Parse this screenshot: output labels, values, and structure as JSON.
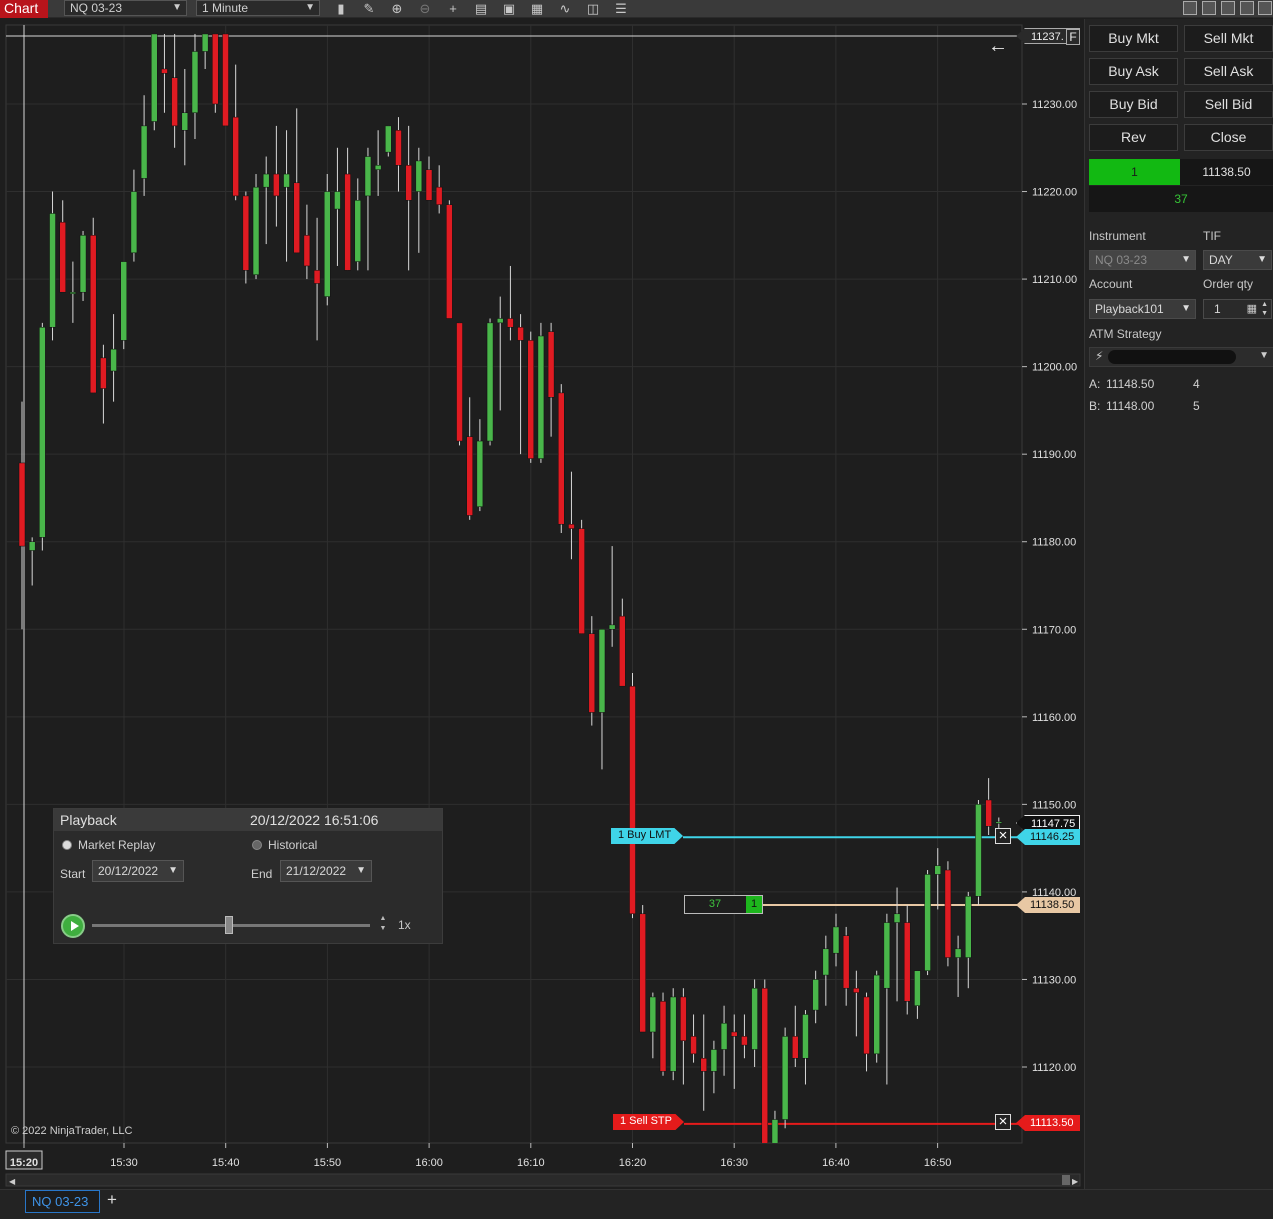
{
  "toolbar": {
    "chart_tab": "Chart",
    "instrument": "NQ 03-23",
    "interval": "1 Minute",
    "icons": [
      "bar-type-icon",
      "draw-tool-icon",
      "zoom-in-icon",
      "zoom-out-icon",
      "crosshair-icon",
      "data-box-icon",
      "template-icon",
      "chart-style-icon",
      "indicators-icon",
      "strategies-icon",
      "properties-icon"
    ]
  },
  "chart": {
    "copyright": "© 2022 NinjaTrader, LLC",
    "price_labels": [
      "11230.00",
      "11220.00",
      "11210.00",
      "11200.00",
      "11190.00",
      "11180.00",
      "11170.00",
      "11160.00",
      "11150.00",
      "11140.00",
      "11130.00",
      "11120.00"
    ],
    "time_labels": [
      "15:20",
      "15:30",
      "15:40",
      "15:50",
      "16:00",
      "16:10",
      "16:20",
      "16:30",
      "16:40",
      "16:50"
    ],
    "top_marker": "11237.",
    "top_marker_flag": "F",
    "last_price": "11147.75",
    "buy_lmt_label": "1  Buy LMT",
    "buy_lmt_price": "11146.25",
    "position_price": "11138.50",
    "sell_stp_label": "1  Sell STP",
    "sell_stp_price": "11113.50",
    "fill_qty": "37",
    "fill_pos": "1",
    "colors": {
      "up": "#49b64a",
      "down": "#e01b22",
      "buy_lmt": "#3fd4e8",
      "position": "#e8c8a4",
      "sell_stp": "#e51b1b"
    }
  },
  "chart_data": {
    "type": "candlestick",
    "instrument": "NQ 03-23",
    "interval": "1 Minute",
    "x_range": [
      "15:20",
      "16:51"
    ],
    "ylim": [
      11108,
      11238
    ],
    "candles": [
      {
        "o": 11189.0,
        "h": 11196.0,
        "l": 11170.0,
        "c": 11179.5
      },
      {
        "o": 11179.0,
        "h": 11180.5,
        "l": 11175.0,
        "c": 11180.0
      },
      {
        "o": 11180.5,
        "h": 11205.0,
        "l": 11179.0,
        "c": 11204.5
      },
      {
        "o": 11204.5,
        "h": 11220.0,
        "l": 11203.0,
        "c": 11217.5
      },
      {
        "o": 11216.5,
        "h": 11219.0,
        "l": 11208.5,
        "c": 11208.5
      },
      {
        "o": 11208.5,
        "h": 11212.0,
        "l": 11205.0,
        "c": 11208.5
      },
      {
        "o": 11208.5,
        "h": 11215.5,
        "l": 11207.5,
        "c": 11215.0
      },
      {
        "o": 11215.0,
        "h": 11217.0,
        "l": 11197.0,
        "c": 11197.0
      },
      {
        "o": 11201.0,
        "h": 11202.5,
        "l": 11193.5,
        "c": 11197.5
      },
      {
        "o": 11199.5,
        "h": 11206.0,
        "l": 11196.0,
        "c": 11202.0
      },
      {
        "o": 11203.0,
        "h": 11212.0,
        "l": 11202.0,
        "c": 11212.0
      },
      {
        "o": 11213.0,
        "h": 11222.5,
        "l": 11212.0,
        "c": 11220.0
      },
      {
        "o": 11221.5,
        "h": 11231.0,
        "l": 11219.5,
        "c": 11227.5
      },
      {
        "o": 11228.0,
        "h": 11238.0,
        "l": 11227.0,
        "c": 11238.0
      },
      {
        "o": 11234.0,
        "h": 11238.0,
        "l": 11229.0,
        "c": 11233.5
      },
      {
        "o": 11233.0,
        "h": 11238.0,
        "l": 11225.0,
        "c": 11227.5
      },
      {
        "o": 11227.0,
        "h": 11234.0,
        "l": 11223.0,
        "c": 11229.0
      },
      {
        "o": 11229.0,
        "h": 11238.0,
        "l": 11226.0,
        "c": 11236.0
      },
      {
        "o": 11236.0,
        "h": 11238.0,
        "l": 11234.0,
        "c": 11238.0
      },
      {
        "o": 11238.0,
        "h": 11238.0,
        "l": 11229.0,
        "c": 11230.0
      },
      {
        "o": 11238.0,
        "h": 11238.0,
        "l": 11227.5,
        "c": 11227.5
      },
      {
        "o": 11228.5,
        "h": 11234.5,
        "l": 11219.0,
        "c": 11219.5
      },
      {
        "o": 11219.5,
        "h": 11220.0,
        "l": 11209.5,
        "c": 11211.0
      },
      {
        "o": 11210.5,
        "h": 11222.0,
        "l": 11210.0,
        "c": 11220.5
      },
      {
        "o": 11220.5,
        "h": 11224.0,
        "l": 11214.0,
        "c": 11222.0
      },
      {
        "o": 11222.0,
        "h": 11227.5,
        "l": 11216.0,
        "c": 11219.5
      },
      {
        "o": 11220.5,
        "h": 11227.0,
        "l": 11212.0,
        "c": 11222.0
      },
      {
        "o": 11221.0,
        "h": 11229.5,
        "l": 11213.0,
        "c": 11213.0
      },
      {
        "o": 11215.0,
        "h": 11218.5,
        "l": 11210.0,
        "c": 11211.5
      },
      {
        "o": 11211.0,
        "h": 11217.0,
        "l": 11203.0,
        "c": 11209.5
      },
      {
        "o": 11208.0,
        "h": 11222.0,
        "l": 11207.0,
        "c": 11220.0
      },
      {
        "o": 11218.0,
        "h": 11225.0,
        "l": 11211.5,
        "c": 11220.0
      },
      {
        "o": 11222.0,
        "h": 11225.0,
        "l": 11211.0,
        "c": 11211.0
      },
      {
        "o": 11212.0,
        "h": 11221.5,
        "l": 11211.0,
        "c": 11219.0
      },
      {
        "o": 11219.5,
        "h": 11225.0,
        "l": 11211.0,
        "c": 11224.0
      },
      {
        "o": 11222.5,
        "h": 11227.0,
        "l": 11219.5,
        "c": 11223.0
      },
      {
        "o": 11224.5,
        "h": 11227.5,
        "l": 11224.0,
        "c": 11227.5
      },
      {
        "o": 11227.0,
        "h": 11228.5,
        "l": 11220.0,
        "c": 11223.0
      },
      {
        "o": 11223.0,
        "h": 11227.5,
        "l": 11211.0,
        "c": 11219.0
      },
      {
        "o": 11220.0,
        "h": 11225.0,
        "l": 11213.0,
        "c": 11223.5
      },
      {
        "o": 11222.5,
        "h": 11224.0,
        "l": 11219.0,
        "c": 11219.0
      },
      {
        "o": 11220.5,
        "h": 11223.0,
        "l": 11217.5,
        "c": 11218.5
      },
      {
        "o": 11218.5,
        "h": 11219.0,
        "l": 11205.5,
        "c": 11205.5
      },
      {
        "o": 11205.0,
        "h": 11205.0,
        "l": 11191.0,
        "c": 11191.5
      },
      {
        "o": 11192.0,
        "h": 11196.5,
        "l": 11182.5,
        "c": 11183.0
      },
      {
        "o": 11184.0,
        "h": 11194.0,
        "l": 11183.5,
        "c": 11191.5
      },
      {
        "o": 11191.5,
        "h": 11205.5,
        "l": 11191.0,
        "c": 11205.0
      },
      {
        "o": 11205.0,
        "h": 11208.0,
        "l": 11195.0,
        "c": 11205.5
      },
      {
        "o": 11205.5,
        "h": 11211.5,
        "l": 11203.0,
        "c": 11204.5
      },
      {
        "o": 11204.5,
        "h": 11206.0,
        "l": 11190.0,
        "c": 11203.0
      },
      {
        "o": 11203.0,
        "h": 11204.0,
        "l": 11189.0,
        "c": 11189.5
      },
      {
        "o": 11189.5,
        "h": 11205.0,
        "l": 11189.0,
        "c": 11203.5
      },
      {
        "o": 11204.0,
        "h": 11205.0,
        "l": 11192.0,
        "c": 11196.5
      },
      {
        "o": 11197.0,
        "h": 11198.0,
        "l": 11181.0,
        "c": 11182.0
      },
      {
        "o": 11182.0,
        "h": 11188.0,
        "l": 11178.0,
        "c": 11181.5
      },
      {
        "o": 11181.5,
        "h": 11182.5,
        "l": 11169.5,
        "c": 11169.5
      },
      {
        "o": 11169.5,
        "h": 11171.5,
        "l": 11159.0,
        "c": 11160.5
      },
      {
        "o": 11160.5,
        "h": 11170.0,
        "l": 11154.0,
        "c": 11170.0
      },
      {
        "o": 11170.0,
        "h": 11179.5,
        "l": 11168.0,
        "c": 11170.5
      },
      {
        "o": 11171.5,
        "h": 11173.5,
        "l": 11164.5,
        "c": 11163.5
      },
      {
        "o": 11163.5,
        "h": 11165.0,
        "l": 11137.0,
        "c": 11137.5
      },
      {
        "o": 11137.5,
        "h": 11138.5,
        "l": 11124.0,
        "c": 11124.0
      },
      {
        "o": 11124.0,
        "h": 11128.5,
        "l": 11121.0,
        "c": 11128.0
      },
      {
        "o": 11127.5,
        "h": 11128.5,
        "l": 11119.0,
        "c": 11119.5
      },
      {
        "o": 11119.5,
        "h": 11129.0,
        "l": 11118.5,
        "c": 11128.0
      },
      {
        "o": 11128.0,
        "h": 11129.0,
        "l": 11118.0,
        "c": 11123.0
      },
      {
        "o": 11123.5,
        "h": 11126.0,
        "l": 11120.5,
        "c": 11121.5
      },
      {
        "o": 11121.0,
        "h": 11126.0,
        "l": 11115.0,
        "c": 11119.5
      },
      {
        "o": 11119.5,
        "h": 11123.0,
        "l": 11117.0,
        "c": 11122.0
      },
      {
        "o": 11122.0,
        "h": 11127.0,
        "l": 11119.0,
        "c": 11125.0
      },
      {
        "o": 11124.0,
        "h": 11126.0,
        "l": 11117.5,
        "c": 11123.5
      },
      {
        "o": 11123.5,
        "h": 11126.0,
        "l": 11121.0,
        "c": 11122.5
      },
      {
        "o": 11122.0,
        "h": 11130.0,
        "l": 11120.0,
        "c": 11129.0
      },
      {
        "o": 11129.0,
        "h": 11130.0,
        "l": 11108.5,
        "c": 11110.0
      },
      {
        "o": 11110.0,
        "h": 11115.0,
        "l": 11108.5,
        "c": 11114.0
      },
      {
        "o": 11114.0,
        "h": 11124.5,
        "l": 11113.0,
        "c": 11123.5
      },
      {
        "o": 11123.5,
        "h": 11127.0,
        "l": 11120.0,
        "c": 11121.0
      },
      {
        "o": 11121.0,
        "h": 11126.5,
        "l": 11118.0,
        "c": 11126.0
      },
      {
        "o": 11126.5,
        "h": 11131.0,
        "l": 11125.0,
        "c": 11130.0
      },
      {
        "o": 11130.5,
        "h": 11135.0,
        "l": 11127.0,
        "c": 11133.5
      },
      {
        "o": 11133.0,
        "h": 11137.5,
        "l": 11131.5,
        "c": 11136.0
      },
      {
        "o": 11135.0,
        "h": 11136.0,
        "l": 11127.0,
        "c": 11129.0
      },
      {
        "o": 11129.0,
        "h": 11131.0,
        "l": 11123.5,
        "c": 11128.5
      },
      {
        "o": 11128.0,
        "h": 11128.5,
        "l": 11119.5,
        "c": 11121.5
      },
      {
        "o": 11121.5,
        "h": 11131.0,
        "l": 11120.5,
        "c": 11130.5
      },
      {
        "o": 11129.0,
        "h": 11137.5,
        "l": 11118.0,
        "c": 11136.5
      },
      {
        "o": 11136.5,
        "h": 11140.5,
        "l": 11127.5,
        "c": 11137.5
      },
      {
        "o": 11136.5,
        "h": 11138.5,
        "l": 11126.0,
        "c": 11127.5
      },
      {
        "o": 11127.0,
        "h": 11131.0,
        "l": 11125.5,
        "c": 11131.0
      },
      {
        "o": 11131.0,
        "h": 11142.5,
        "l": 11130.5,
        "c": 11142.0
      },
      {
        "o": 11142.0,
        "h": 11145.0,
        "l": 11138.0,
        "c": 11143.0
      },
      {
        "o": 11142.5,
        "h": 11143.5,
        "l": 11131.5,
        "c": 11132.5
      },
      {
        "o": 11132.5,
        "h": 11135.0,
        "l": 11128.0,
        "c": 11133.5
      },
      {
        "o": 11132.5,
        "h": 11140.0,
        "l": 11129.0,
        "c": 11139.5
      },
      {
        "o": 11139.5,
        "h": 11150.5,
        "l": 11138.5,
        "c": 11150.0
      },
      {
        "o": 11150.5,
        "h": 11153.0,
        "l": 11146.5,
        "c": 11147.5
      },
      {
        "o": 11148.0,
        "h": 11148.5,
        "l": 11147.0,
        "c": 11148.0
      }
    ]
  },
  "playback": {
    "title": "Playback",
    "datetime": "20/12/2022 16:51:06",
    "mode_replay": "Market Replay",
    "mode_historical": "Historical",
    "start_label": "Start",
    "start_date": "20/12/2022",
    "end_label": "End",
    "end_date": "21/12/2022",
    "speed": "1x",
    "slider_position": 0.5
  },
  "order_panel": {
    "buttons": {
      "buy_mkt": "Buy Mkt",
      "sell_mkt": "Sell Mkt",
      "buy_ask": "Buy Ask",
      "sell_ask": "Sell Ask",
      "buy_bid": "Buy Bid",
      "sell_bid": "Sell Bid",
      "rev": "Rev",
      "close": "Close"
    },
    "position_qty": "1",
    "position_price": "11138.50",
    "unrealized_pnl": "37",
    "instrument_label": "Instrument",
    "instrument_value": "NQ 03-23",
    "tif_label": "TIF",
    "tif_value": "DAY",
    "account_label": "Account",
    "account_value": "Playback101",
    "order_qty_label": "Order qty",
    "order_qty_value": "1",
    "atm_label": "ATM Strategy",
    "ask_label": "A:",
    "ask_price": "11148.50",
    "ask_size": "4",
    "bid_label": "B:",
    "bid_price": "11148.00",
    "bid_size": "5"
  },
  "bottom": {
    "tab": "NQ 03-23",
    "add": "+"
  }
}
